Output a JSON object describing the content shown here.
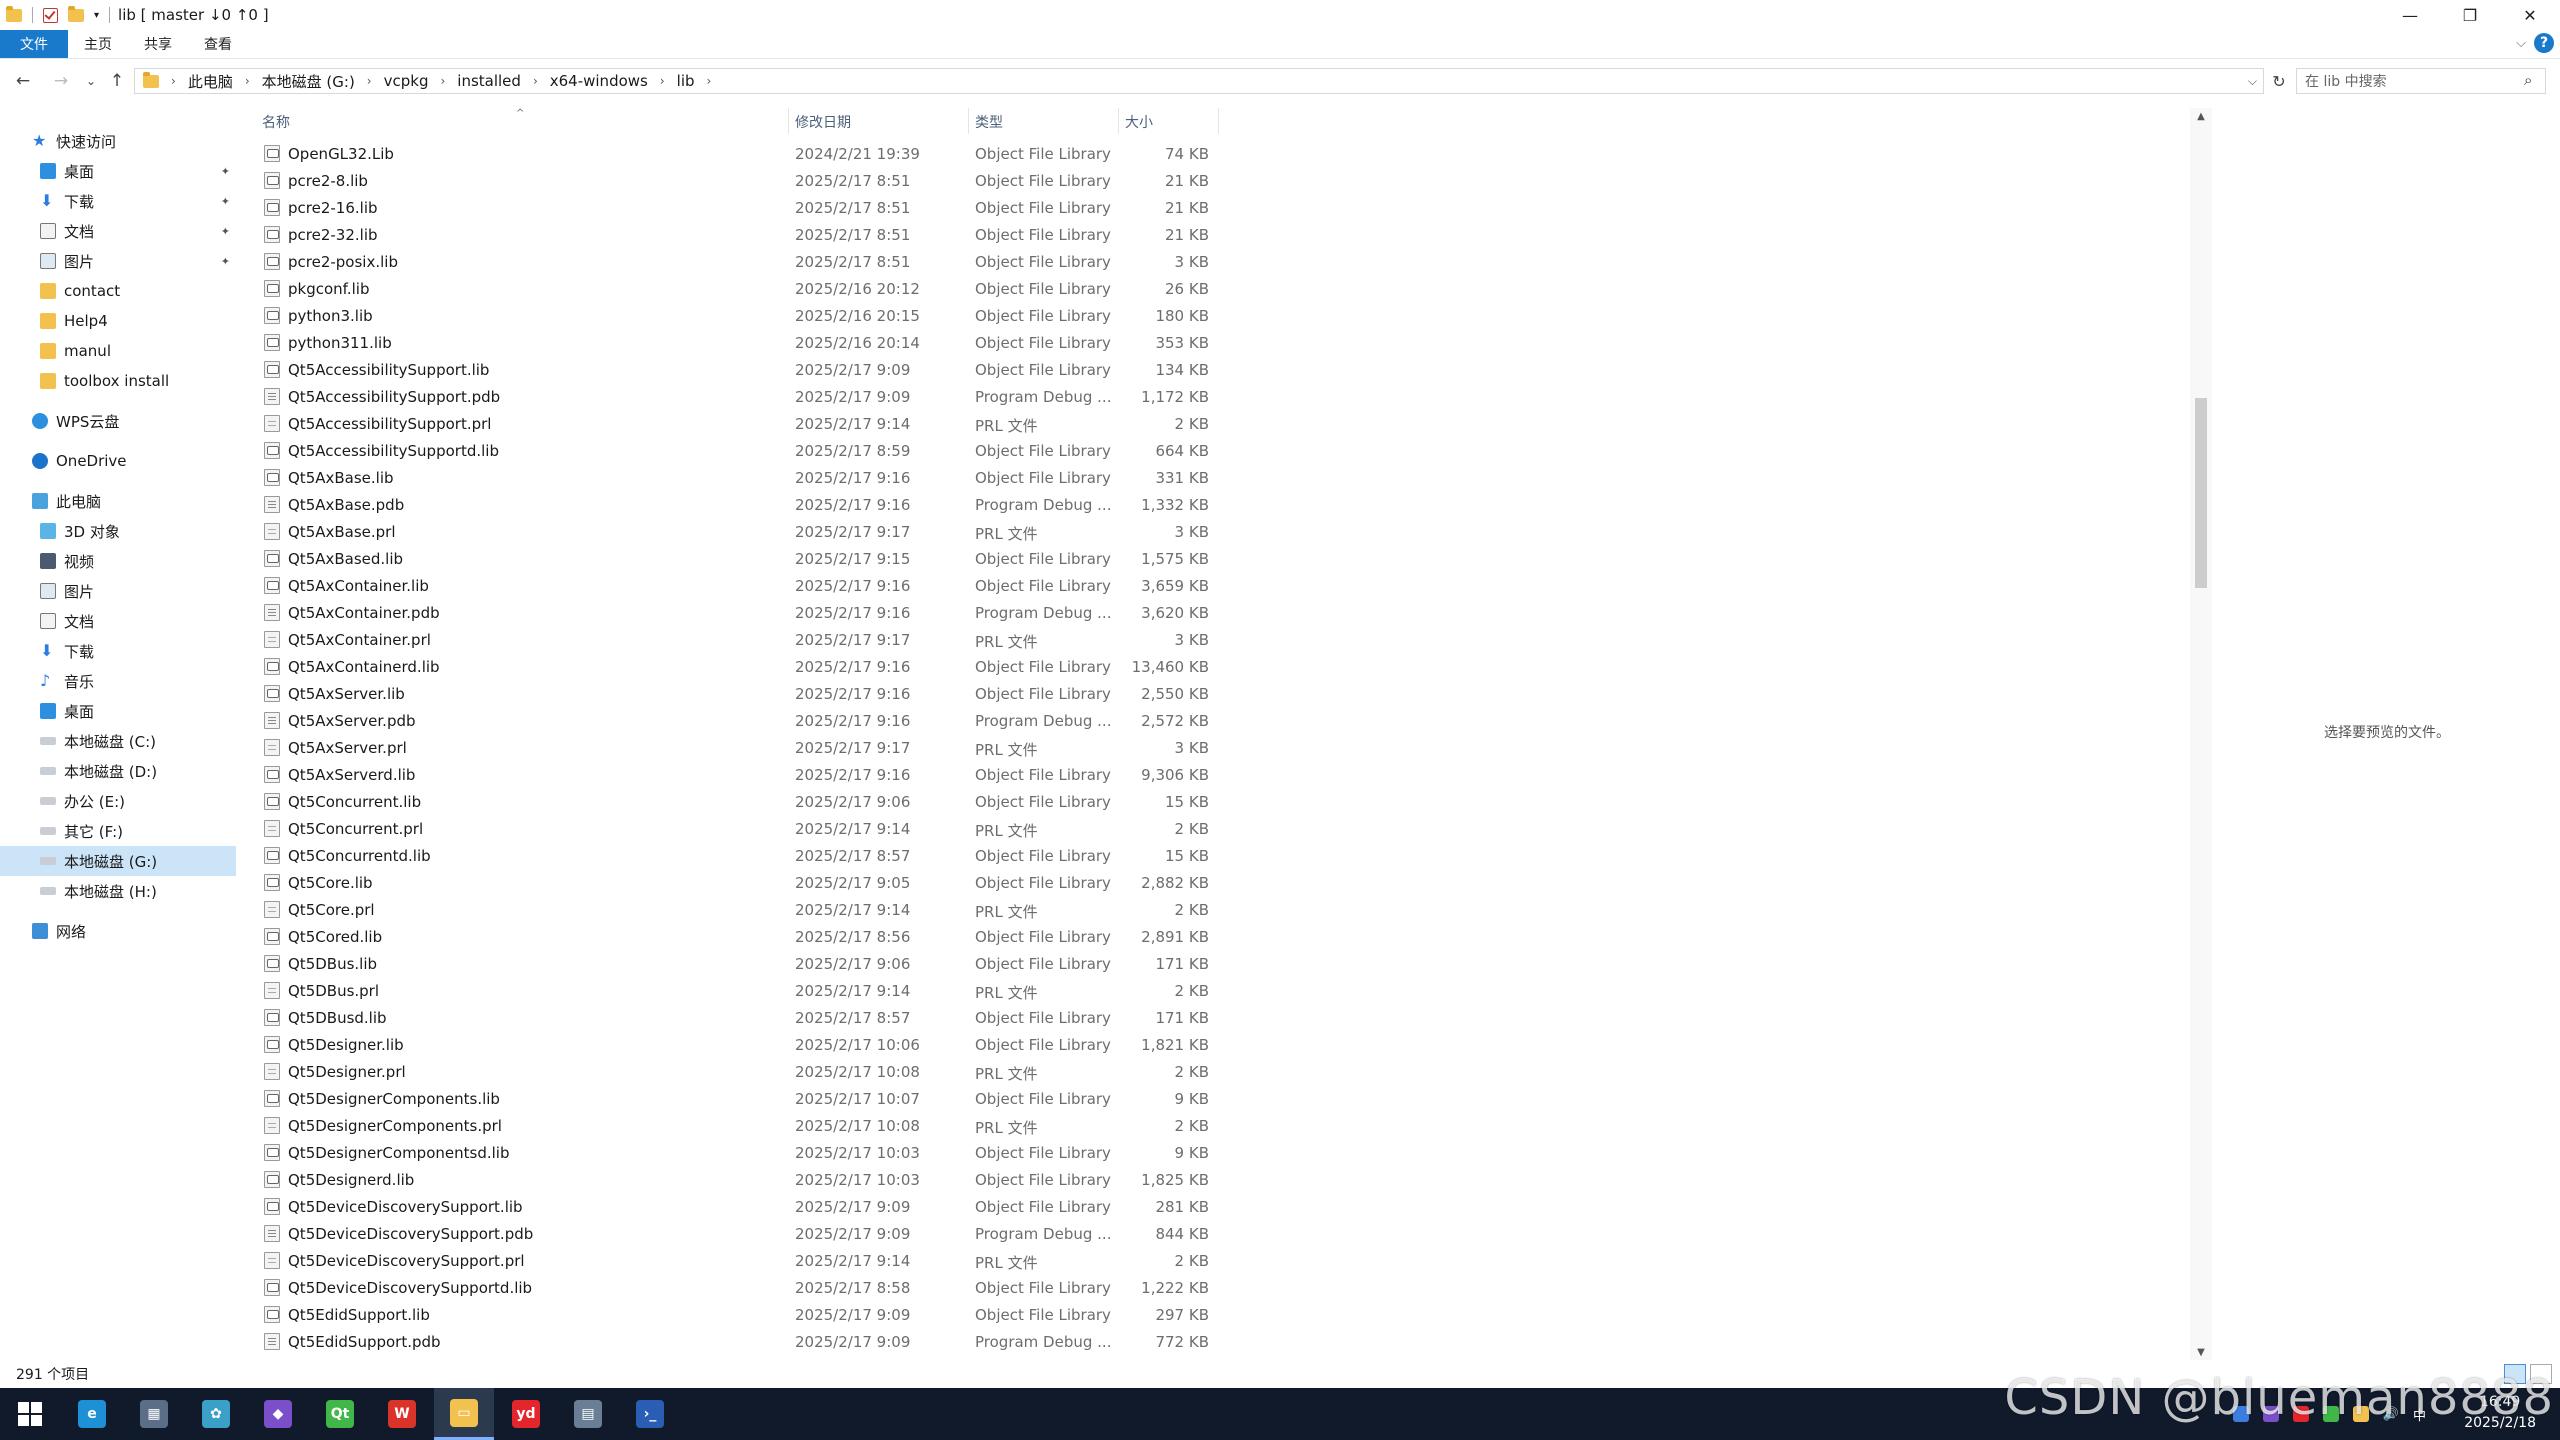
{
  "window": {
    "title": "lib [ master ↓0 ↑0 ]",
    "controls": {
      "minimize": "—",
      "maximize": "❐",
      "close": "✕"
    }
  },
  "ribbon": {
    "tabs": [
      "文件",
      "主页",
      "共享",
      "查看"
    ],
    "expand_glyph": "⌵",
    "help_glyph": "?"
  },
  "nav": {
    "back": "←",
    "forward": "→",
    "recent": "⌄",
    "up": "↑"
  },
  "address": {
    "breadcrumbs": [
      "此电脑",
      "本地磁盘 (G:)",
      "vcpkg",
      "installed",
      "x64-windows",
      "lib"
    ],
    "refresh": "↻",
    "dropdown": "⌵"
  },
  "search": {
    "placeholder": "在 lib 中搜索",
    "icon": "⌕"
  },
  "navpane": {
    "quick_access": "快速访问",
    "quick_items": [
      "桌面",
      "下载",
      "文档",
      "图片",
      "contact",
      "Help4",
      "manul",
      "toolbox install"
    ],
    "wps": "WPS云盘",
    "onedrive": "OneDrive",
    "this_pc": "此电脑",
    "pc_items": [
      "3D 对象",
      "视频",
      "图片",
      "文档",
      "下载",
      "音乐",
      "桌面",
      "本地磁盘 (C:)",
      "本地磁盘 (D:)",
      "办公 (E:)",
      "其它 (F:)",
      "本地磁盘 (G:)",
      "本地磁盘 (H:)"
    ],
    "network": "网络",
    "pin_glyph": "📌"
  },
  "columns": {
    "name": "名称",
    "date": "修改日期",
    "type": "类型",
    "size": "大小",
    "sort_glyph": "^"
  },
  "files": [
    {
      "name": "OpenGL32.Lib",
      "date": "2024/2/21 19:39",
      "type": "Object File Library",
      "size": "74 KB",
      "kind": "lib"
    },
    {
      "name": "pcre2-8.lib",
      "date": "2025/2/17 8:51",
      "type": "Object File Library",
      "size": "21 KB",
      "kind": "lib"
    },
    {
      "name": "pcre2-16.lib",
      "date": "2025/2/17 8:51",
      "type": "Object File Library",
      "size": "21 KB",
      "kind": "lib"
    },
    {
      "name": "pcre2-32.lib",
      "date": "2025/2/17 8:51",
      "type": "Object File Library",
      "size": "21 KB",
      "kind": "lib"
    },
    {
      "name": "pcre2-posix.lib",
      "date": "2025/2/17 8:51",
      "type": "Object File Library",
      "size": "3 KB",
      "kind": "lib"
    },
    {
      "name": "pkgconf.lib",
      "date": "2025/2/16 20:12",
      "type": "Object File Library",
      "size": "26 KB",
      "kind": "lib"
    },
    {
      "name": "python3.lib",
      "date": "2025/2/16 20:15",
      "type": "Object File Library",
      "size": "180 KB",
      "kind": "lib"
    },
    {
      "name": "python311.lib",
      "date": "2025/2/16 20:14",
      "type": "Object File Library",
      "size": "353 KB",
      "kind": "lib"
    },
    {
      "name": "Qt5AccessibilitySupport.lib",
      "date": "2025/2/17 9:09",
      "type": "Object File Library",
      "size": "134 KB",
      "kind": "lib"
    },
    {
      "name": "Qt5AccessibilitySupport.pdb",
      "date": "2025/2/17 9:09",
      "type": "Program Debug ...",
      "size": "1,172 KB",
      "kind": "pdb"
    },
    {
      "name": "Qt5AccessibilitySupport.prl",
      "date": "2025/2/17 9:14",
      "type": "PRL 文件",
      "size": "2 KB",
      "kind": "prl"
    },
    {
      "name": "Qt5AccessibilitySupportd.lib",
      "date": "2025/2/17 8:59",
      "type": "Object File Library",
      "size": "664 KB",
      "kind": "lib"
    },
    {
      "name": "Qt5AxBase.lib",
      "date": "2025/2/17 9:16",
      "type": "Object File Library",
      "size": "331 KB",
      "kind": "lib"
    },
    {
      "name": "Qt5AxBase.pdb",
      "date": "2025/2/17 9:16",
      "type": "Program Debug ...",
      "size": "1,332 KB",
      "kind": "pdb"
    },
    {
      "name": "Qt5AxBase.prl",
      "date": "2025/2/17 9:17",
      "type": "PRL 文件",
      "size": "3 KB",
      "kind": "prl"
    },
    {
      "name": "Qt5AxBased.lib",
      "date": "2025/2/17 9:15",
      "type": "Object File Library",
      "size": "1,575 KB",
      "kind": "lib"
    },
    {
      "name": "Qt5AxContainer.lib",
      "date": "2025/2/17 9:16",
      "type": "Object File Library",
      "size": "3,659 KB",
      "kind": "lib"
    },
    {
      "name": "Qt5AxContainer.pdb",
      "date": "2025/2/17 9:16",
      "type": "Program Debug ...",
      "size": "3,620 KB",
      "kind": "pdb"
    },
    {
      "name": "Qt5AxContainer.prl",
      "date": "2025/2/17 9:17",
      "type": "PRL 文件",
      "size": "3 KB",
      "kind": "prl"
    },
    {
      "name": "Qt5AxContainerd.lib",
      "date": "2025/2/17 9:16",
      "type": "Object File Library",
      "size": "13,460 KB",
      "kind": "lib"
    },
    {
      "name": "Qt5AxServer.lib",
      "date": "2025/2/17 9:16",
      "type": "Object File Library",
      "size": "2,550 KB",
      "kind": "lib"
    },
    {
      "name": "Qt5AxServer.pdb",
      "date": "2025/2/17 9:16",
      "type": "Program Debug ...",
      "size": "2,572 KB",
      "kind": "pdb"
    },
    {
      "name": "Qt5AxServer.prl",
      "date": "2025/2/17 9:17",
      "type": "PRL 文件",
      "size": "3 KB",
      "kind": "prl"
    },
    {
      "name": "Qt5AxServerd.lib",
      "date": "2025/2/17 9:16",
      "type": "Object File Library",
      "size": "9,306 KB",
      "kind": "lib"
    },
    {
      "name": "Qt5Concurrent.lib",
      "date": "2025/2/17 9:06",
      "type": "Object File Library",
      "size": "15 KB",
      "kind": "lib"
    },
    {
      "name": "Qt5Concurrent.prl",
      "date": "2025/2/17 9:14",
      "type": "PRL 文件",
      "size": "2 KB",
      "kind": "prl"
    },
    {
      "name": "Qt5Concurrentd.lib",
      "date": "2025/2/17 8:57",
      "type": "Object File Library",
      "size": "15 KB",
      "kind": "lib"
    },
    {
      "name": "Qt5Core.lib",
      "date": "2025/2/17 9:05",
      "type": "Object File Library",
      "size": "2,882 KB",
      "kind": "lib"
    },
    {
      "name": "Qt5Core.prl",
      "date": "2025/2/17 9:14",
      "type": "PRL 文件",
      "size": "2 KB",
      "kind": "prl"
    },
    {
      "name": "Qt5Cored.lib",
      "date": "2025/2/17 8:56",
      "type": "Object File Library",
      "size": "2,891 KB",
      "kind": "lib"
    },
    {
      "name": "Qt5DBus.lib",
      "date": "2025/2/17 9:06",
      "type": "Object File Library",
      "size": "171 KB",
      "kind": "lib"
    },
    {
      "name": "Qt5DBus.prl",
      "date": "2025/2/17 9:14",
      "type": "PRL 文件",
      "size": "2 KB",
      "kind": "prl"
    },
    {
      "name": "Qt5DBusd.lib",
      "date": "2025/2/17 8:57",
      "type": "Object File Library",
      "size": "171 KB",
      "kind": "lib"
    },
    {
      "name": "Qt5Designer.lib",
      "date": "2025/2/17 10:06",
      "type": "Object File Library",
      "size": "1,821 KB",
      "kind": "lib"
    },
    {
      "name": "Qt5Designer.prl",
      "date": "2025/2/17 10:08",
      "type": "PRL 文件",
      "size": "2 KB",
      "kind": "prl"
    },
    {
      "name": "Qt5DesignerComponents.lib",
      "date": "2025/2/17 10:07",
      "type": "Object File Library",
      "size": "9 KB",
      "kind": "lib"
    },
    {
      "name": "Qt5DesignerComponents.prl",
      "date": "2025/2/17 10:08",
      "type": "PRL 文件",
      "size": "2 KB",
      "kind": "prl"
    },
    {
      "name": "Qt5DesignerComponentsd.lib",
      "date": "2025/2/17 10:03",
      "type": "Object File Library",
      "size": "9 KB",
      "kind": "lib"
    },
    {
      "name": "Qt5Designerd.lib",
      "date": "2025/2/17 10:03",
      "type": "Object File Library",
      "size": "1,825 KB",
      "kind": "lib"
    },
    {
      "name": "Qt5DeviceDiscoverySupport.lib",
      "date": "2025/2/17 9:09",
      "type": "Object File Library",
      "size": "281 KB",
      "kind": "lib"
    },
    {
      "name": "Qt5DeviceDiscoverySupport.pdb",
      "date": "2025/2/17 9:09",
      "type": "Program Debug ...",
      "size": "844 KB",
      "kind": "pdb"
    },
    {
      "name": "Qt5DeviceDiscoverySupport.prl",
      "date": "2025/2/17 9:14",
      "type": "PRL 文件",
      "size": "2 KB",
      "kind": "prl"
    },
    {
      "name": "Qt5DeviceDiscoverySupportd.lib",
      "date": "2025/2/17 8:58",
      "type": "Object File Library",
      "size": "1,222 KB",
      "kind": "lib"
    },
    {
      "name": "Qt5EdidSupport.lib",
      "date": "2025/2/17 9:09",
      "type": "Object File Library",
      "size": "297 KB",
      "kind": "lib"
    },
    {
      "name": "Qt5EdidSupport.pdb",
      "date": "2025/2/17 9:09",
      "type": "Program Debug ...",
      "size": "772 KB",
      "kind": "pdb"
    }
  ],
  "preview": {
    "message": "选择要预览的文件。"
  },
  "status": {
    "item_count": "291 个项目"
  },
  "taskbar": {
    "apps": [
      {
        "name": "edge",
        "label": "e",
        "color": "#1e90d6"
      },
      {
        "name": "calculator",
        "label": "▦",
        "color": "#5a6e88"
      },
      {
        "name": "pinwheel",
        "label": "✿",
        "color": "#3aa0c8"
      },
      {
        "name": "visual-studio",
        "label": "◆",
        "color": "#7b4fc9"
      },
      {
        "name": "qt-creator",
        "label": "Qt",
        "color": "#41b649"
      },
      {
        "name": "wps",
        "label": "W",
        "color": "#d9332a"
      },
      {
        "name": "file-explorer",
        "label": "▭",
        "color": "#f2c14e"
      },
      {
        "name": "youdao",
        "label": "yd",
        "color": "#e5252c"
      },
      {
        "name": "remote",
        "label": "▤",
        "color": "#6a7f96"
      },
      {
        "name": "powershell",
        "label": "›_",
        "color": "#2a5eb5"
      }
    ],
    "tray_ime": "中",
    "tray_volume": "🔊",
    "clock_time": "16:49",
    "clock_date": "2025/2/18"
  },
  "watermark": "CSDN @blueman8888"
}
